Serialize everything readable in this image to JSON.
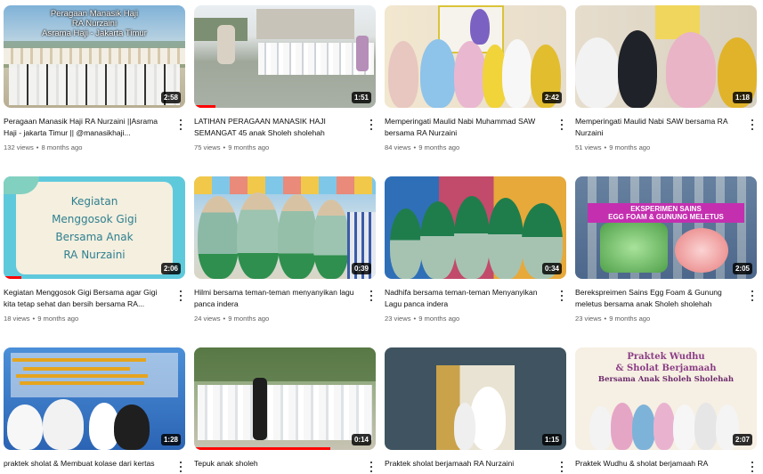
{
  "videos": [
    {
      "title": "Peragaan Manasik Haji RA Nurzaini ||Asrama Haji - jakarta Timur || @manasikhaji...",
      "views": "132 views",
      "age": "8 months ago",
      "duration": "2:58",
      "thumb_overlay": [
        "Peragaan Manasik Haji",
        "RA Nurzaini",
        "Asrama Haji - Jakarta Timur"
      ]
    },
    {
      "title": "LATIHAN PERAGAAN MANASIK HAJI SEMANGAT 45 anak Sholeh sholehah",
      "views": "75 views",
      "age": "9 months ago",
      "duration": "1:51",
      "progress": 0.12
    },
    {
      "title": "Memperingati Maulid Nabi Muhammad SAW bersama RA Nurzaini",
      "views": "84 views",
      "age": "9 months ago",
      "duration": "2:42"
    },
    {
      "title": "Memperingati Maulid Nabi SAW bersama RA Nurzaini",
      "views": "51 views",
      "age": "9 months ago",
      "duration": "1:18"
    },
    {
      "title": "Kegiatan Menggosok Gigi Bersama agar Gigi kita tetap sehat dan bersih bersama RA...",
      "views": "18 views",
      "age": "9 months ago",
      "duration": "2:06",
      "progress": 0.1,
      "thumb_overlay": [
        "Kegiatan",
        "Menggosok Gigi",
        "Bersama Anak",
        "RA Nurzaini"
      ]
    },
    {
      "title": "Hilmi bersama teman-teman menyanyikan lagu panca indera",
      "views": "24 views",
      "age": "9 months ago",
      "duration": "0:39"
    },
    {
      "title": "Nadhifa bersama teman-teman Menyanyikan Lagu panca indera",
      "views": "23 views",
      "age": "9 months ago",
      "duration": "0:34"
    },
    {
      "title": "Berekspreimen Sains Egg Foam & Gunung meletus bersama anak Sholeh sholehah",
      "views": "23 views",
      "age": "9 months ago",
      "duration": "2:05",
      "thumb_overlay": [
        "EKSPERIMEN SAINS",
        "EGG FOAM & GUNUNG MELETUS"
      ]
    },
    {
      "title": "praktek sholat & Membuat kolase dari kertas",
      "views": "",
      "age": "",
      "duration": "1:28"
    },
    {
      "title": "Tepuk anak sholeh",
      "views": "",
      "age": "",
      "duration": "0:14",
      "progress": 0.75
    },
    {
      "title": "Praktek sholat berjamaah RA Nurzaini",
      "views": "",
      "age": "",
      "duration": "1:15"
    },
    {
      "title": "Praktek Wudhu & sholat berjamaah RA",
      "views": "",
      "age": "",
      "duration": "2:07",
      "thumb_overlay": [
        "Praktek Wudhu",
        "& Sholat Berjamaah",
        "Bersama Anak Sholeh Sholehah"
      ]
    }
  ],
  "colors": {
    "progress": "#ff0000",
    "meta": "#606060",
    "title": "#0f0f0f"
  },
  "icons": {
    "more": "more-vertical-icon"
  }
}
